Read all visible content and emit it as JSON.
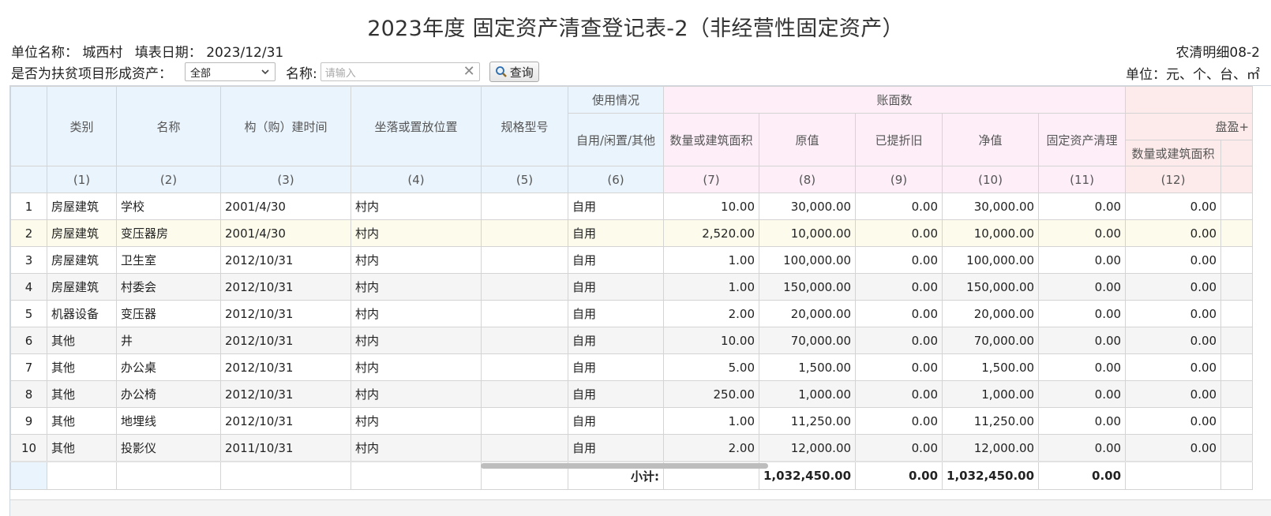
{
  "title": "2023年度 固定资产清查登记表-2（非经营性固定资产）",
  "info": {
    "unit_label": "单位名称：",
    "unit_value": "城西村",
    "date_label": "填表日期：",
    "date_value": "2023/12/31",
    "code": "农清明细08-2",
    "units": "单位：元、个、台、㎡"
  },
  "filter": {
    "poverty_label": "是否为扶贫项目形成资产：",
    "poverty_value": "全部",
    "name_label": "名称:",
    "name_placeholder": "请输入",
    "search_label": "查询"
  },
  "table": {
    "group_usage": "使用情况",
    "group_book": "账面数",
    "group_surplus": "盘盈+",
    "h_category": "类别",
    "h_name": "名称",
    "h_time": "构（购）建时间",
    "h_location": "坐落或置放位置",
    "h_spec": "规格型号",
    "h_usage": "自用/闲置/其他",
    "h_qty": "数量或建筑面积",
    "h_orig": "原值",
    "h_dep": "已提折旧",
    "h_net": "净值",
    "h_clear": "固定资产清理",
    "h_sqty": "数量或建筑面积",
    "codes": [
      "(1)",
      "(2)",
      "(3)",
      "(4)",
      "(5)",
      "(6)",
      "(7)",
      "(8)",
      "(9)",
      "(10)",
      "(11)",
      "(12)"
    ],
    "rows": [
      [
        "1",
        "房屋建筑",
        "学校",
        "2001/4/30",
        "村内",
        "",
        "自用",
        "10.00",
        "30,000.00",
        "0.00",
        "30,000.00",
        "0.00",
        "0.00"
      ],
      [
        "2",
        "房屋建筑",
        "变压器房",
        "2001/4/30",
        "村内",
        "",
        "自用",
        "2,520.00",
        "10,000.00",
        "0.00",
        "10,000.00",
        "0.00",
        "0.00"
      ],
      [
        "3",
        "房屋建筑",
        "卫生室",
        "2012/10/31",
        "村内",
        "",
        "自用",
        "1.00",
        "100,000.00",
        "0.00",
        "100,000.00",
        "0.00",
        "0.00"
      ],
      [
        "4",
        "房屋建筑",
        "村委会",
        "2012/10/31",
        "村内",
        "",
        "自用",
        "1.00",
        "150,000.00",
        "0.00",
        "150,000.00",
        "0.00",
        "0.00"
      ],
      [
        "5",
        "机器设备",
        "变压器",
        "2012/10/31",
        "村内",
        "",
        "自用",
        "2.00",
        "20,000.00",
        "0.00",
        "20,000.00",
        "0.00",
        "0.00"
      ],
      [
        "6",
        "其他",
        "井",
        "2012/10/31",
        "村内",
        "",
        "自用",
        "10.00",
        "70,000.00",
        "0.00",
        "70,000.00",
        "0.00",
        "0.00"
      ],
      [
        "7",
        "其他",
        "办公桌",
        "2012/10/31",
        "村内",
        "",
        "自用",
        "5.00",
        "1,500.00",
        "0.00",
        "1,500.00",
        "0.00",
        "0.00"
      ],
      [
        "8",
        "其他",
        "办公椅",
        "2012/10/31",
        "村内",
        "",
        "自用",
        "250.00",
        "1,000.00",
        "0.00",
        "1,000.00",
        "0.00",
        "0.00"
      ],
      [
        "9",
        "其他",
        "地埋线",
        "2012/10/31",
        "村内",
        "",
        "自用",
        "1.00",
        "11,250.00",
        "0.00",
        "11,250.00",
        "0.00",
        "0.00"
      ],
      [
        "10",
        "其他",
        "投影仪",
        "2011/10/31",
        "村内",
        "",
        "自用",
        "2.00",
        "12,000.00",
        "0.00",
        "12,000.00",
        "0.00",
        "0.00"
      ]
    ],
    "subtotal_label": "小计:",
    "subtotal_orig": "1,032,450.00",
    "subtotal_dep": "0.00",
    "subtotal_net": "1,032,450.00",
    "subtotal_clear": "0.00"
  }
}
